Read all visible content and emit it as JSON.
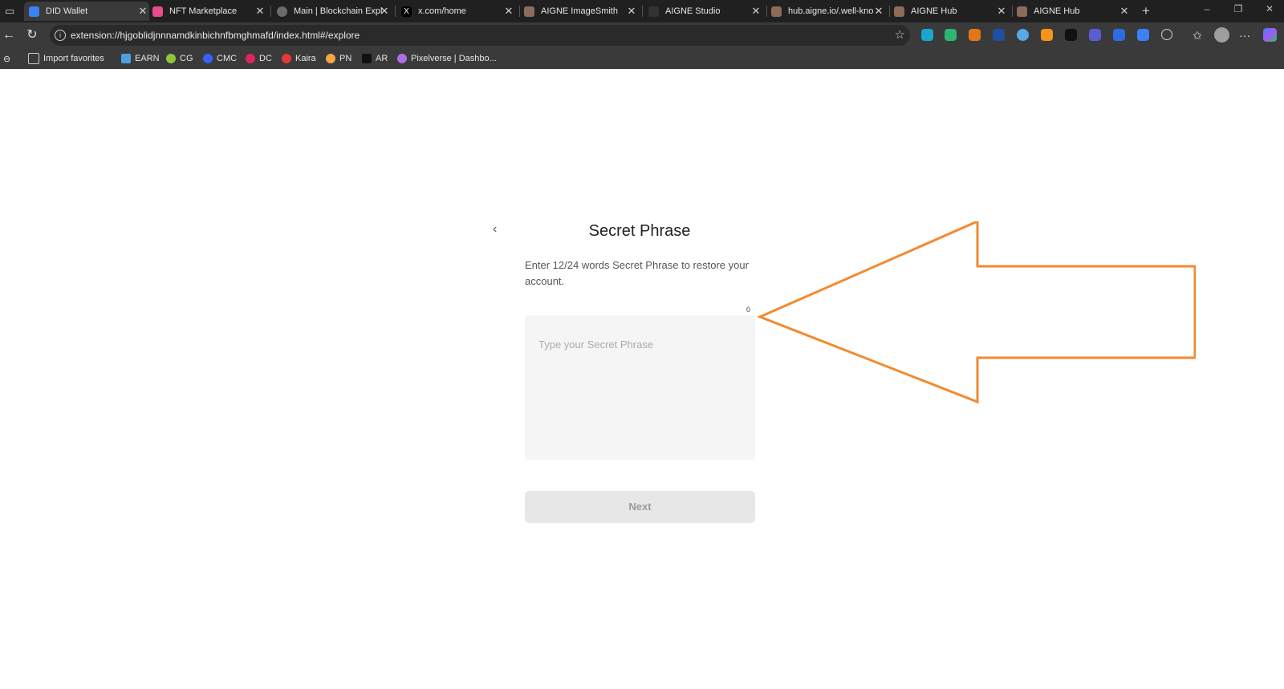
{
  "tabs": [
    {
      "title": "DID Wallet",
      "active": true,
      "color": "#3b82f6"
    },
    {
      "title": "NFT Marketplace",
      "active": false,
      "color": "#e74c8b"
    },
    {
      "title": "Main | Blockchain Expl",
      "active": false,
      "color": "#6b6b6b"
    },
    {
      "title": "x.com/home",
      "active": false,
      "color": "#000000"
    },
    {
      "title": "AIGNE ImageSmith",
      "active": false,
      "color": "#8d6a5a"
    },
    {
      "title": "AIGNE Studio",
      "active": false,
      "color": "#333333"
    },
    {
      "title": "hub.aigne.io/.well-kno",
      "active": false,
      "color": "#8d6a5a"
    },
    {
      "title": "AIGNE Hub",
      "active": false,
      "color": "#8d6a5a"
    },
    {
      "title": "AIGNE Hub",
      "active": false,
      "color": "#8d6a5a"
    }
  ],
  "address_bar": {
    "url": "extension://hjgoblidjnnnamdkinbichnfbmghmafd/index.html#/explore"
  },
  "bookmarks": [
    {
      "label": "Import favorites",
      "color": "#cccccc"
    },
    {
      "label": "EARN",
      "color": "#4aa3df"
    },
    {
      "label": "CG",
      "color": "#8dc63f"
    },
    {
      "label": "CMC",
      "color": "#3861fb"
    },
    {
      "label": "DC",
      "color": "#e0245e"
    },
    {
      "label": "Kaira",
      "color": "#e53935"
    },
    {
      "label": "PN",
      "color": "#f4a742"
    },
    {
      "label": "AR",
      "color": "#111111"
    },
    {
      "label": "Pixelverse | Dashbo...",
      "color": "#b06ee6"
    }
  ],
  "page": {
    "heading": "Secret Phrase",
    "description": "Enter 12/24 words Secret Phrase to restore your account.",
    "word_count": "0",
    "phrase_placeholder": "Type your Secret Phrase",
    "next_label": "Next"
  },
  "annotation": {
    "arrow_color": "#f28a30"
  }
}
